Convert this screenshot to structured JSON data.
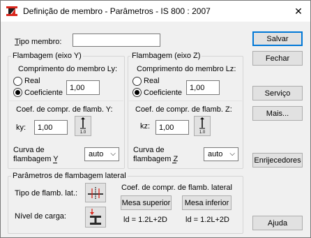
{
  "window": {
    "title": "Definição de membro - Parâmetros - IS 800 : 2007",
    "close_glyph": "✕",
    "app_icon": "app-logo-icon"
  },
  "member_type": {
    "label": "Tipo membro:",
    "value": ""
  },
  "buckling_y": {
    "title": "Flambagem (eixo Y)",
    "length_label": "Comprimento do membro Ly:",
    "real_label": "Real",
    "coef_label": "Coeficiente",
    "selected": "coef",
    "length_value": "1,00",
    "kcoef_label": "Coef. de compr. de flamb. Y:",
    "k_label": "ky:",
    "k_value": "1,00",
    "k_icon_text": "1.0",
    "curve_label_1": "Curva de",
    "curve_label_2": "flambagem Y",
    "curve_value": "auto"
  },
  "buckling_z": {
    "title": "Flambagem (eixo Z)",
    "length_label": "Comprimento do membro Lz:",
    "real_label": "Real",
    "coef_label": "Coeficiente",
    "selected": "coef",
    "length_value": "1,00",
    "kcoef_label": "Coef. de compr. de flamb. Z:",
    "k_label": "kz:",
    "k_value": "1,00",
    "k_icon_text": "1.0",
    "curve_label_1": "Curva de",
    "curve_label_2": "flambagem Z",
    "curve_value": "auto"
  },
  "lateral": {
    "title": "Parâmetros de flambagem lateral",
    "type_label": "Tipo de flamb. lat.:",
    "load_level_label": "Nível de carga:",
    "coef_label": "Coef. de compr. de flamb. lateral",
    "upper_flange": "Mesa superior",
    "lower_flange": "Mesa inferior",
    "ld_upper": "ld = 1.2L+2D",
    "ld_lower": "ld = 1.2L+2D"
  },
  "buttons": {
    "save": "Salvar",
    "close": "Fechar",
    "service": "Serviço",
    "more": "Mais...",
    "stiffeners": "Enrijecedores",
    "help": "Ajuda"
  },
  "colors": {
    "accent": "#0078d7",
    "logo_red": "#d9261c"
  }
}
